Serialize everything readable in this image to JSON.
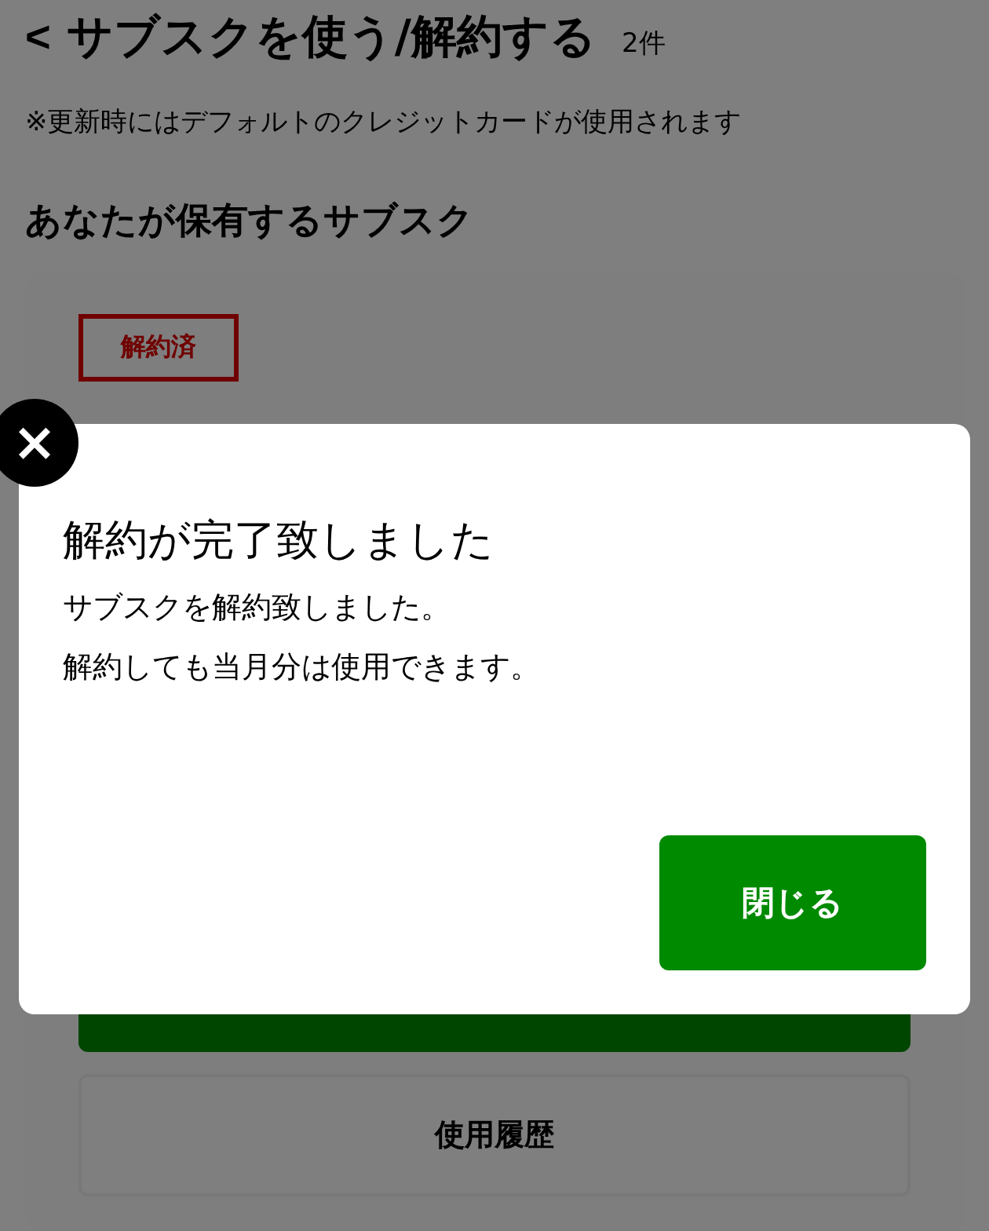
{
  "header": {
    "back": "<",
    "title": "サブスクを使う/解約する",
    "count": "2件"
  },
  "notice": "※更新時にはデフォルトのクレジットカードが使用されます",
  "section_title": "あなたが保有するサブスク",
  "card": {
    "status": "解約済",
    "history_button": "使用履歴"
  },
  "dialog": {
    "close": "×",
    "title": "解約が完了致しました",
    "lines": [
      "サブスクを解約致しました。",
      "解約しても当月分は使用できます。"
    ],
    "button": "閉じる"
  }
}
